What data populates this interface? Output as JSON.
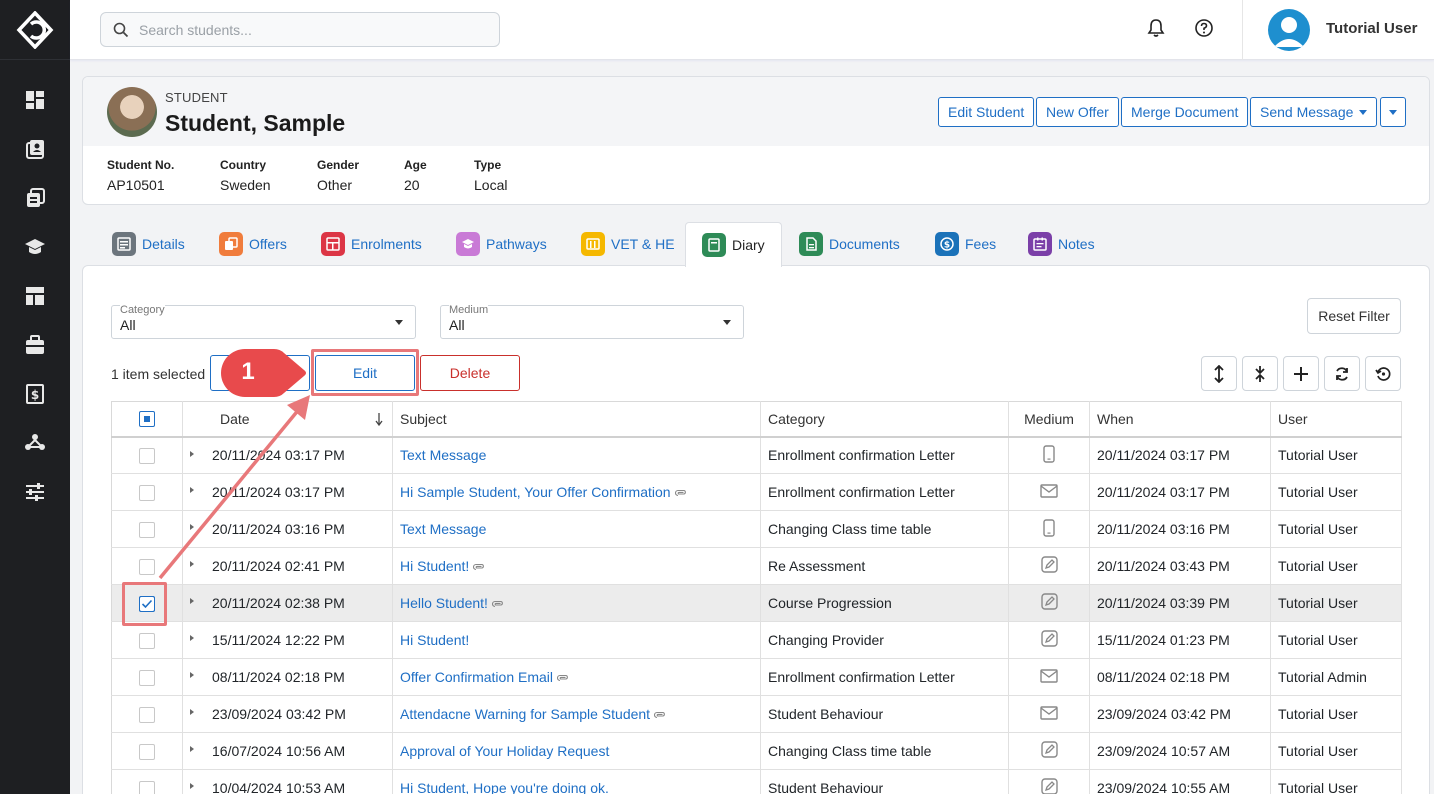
{
  "search": {
    "placeholder": "Search students..."
  },
  "user": {
    "name": "Tutorial User"
  },
  "student": {
    "role": "STUDENT",
    "name": "Student, Sample",
    "buttons": {
      "edit": "Edit Student",
      "offer": "New Offer",
      "merge": "Merge Document",
      "send": "Send Message"
    },
    "fields": [
      {
        "label": "Student No.",
        "value": "AP10501"
      },
      {
        "label": "Country",
        "value": "Sweden"
      },
      {
        "label": "Gender",
        "value": "Other"
      },
      {
        "label": "Age",
        "value": "20"
      },
      {
        "label": "Type",
        "value": "Local"
      }
    ]
  },
  "tabs": [
    {
      "label": "Details",
      "color": "#6c757d"
    },
    {
      "label": "Offers",
      "color": "#f07c3c"
    },
    {
      "label": "Enrolments",
      "color": "#dc3545"
    },
    {
      "label": "Pathways",
      "color": "#c97ad6"
    },
    {
      "label": "VET & HE",
      "color": "#f5b800"
    },
    {
      "label": "Diary",
      "color": "#2e8b57"
    },
    {
      "label": "Documents",
      "color": "#2e8b57"
    },
    {
      "label": "Fees",
      "color": "#1b72b9"
    },
    {
      "label": "Notes",
      "color": "#7b3fa8"
    }
  ],
  "filters": {
    "category": {
      "label": "Category",
      "value": "All"
    },
    "medium": {
      "label": "Medium",
      "value": "All"
    },
    "reset": "Reset Filter"
  },
  "selection": {
    "text": "1 item selected",
    "edit": "Edit",
    "delete": "Delete"
  },
  "annotation": {
    "step": "1"
  },
  "table": {
    "headers": {
      "date": "Date",
      "subject": "Subject",
      "category": "Category",
      "medium": "Medium",
      "when": "When",
      "user": "User"
    },
    "rows": [
      {
        "date": "20/11/2024 03:17 PM",
        "subject": "Text Message",
        "attach": false,
        "category": "Enrollment confirmation Letter",
        "medium": "phone",
        "when": "20/11/2024 03:17 PM",
        "user": "Tutorial User",
        "checked": false
      },
      {
        "date": "20/11/2024 03:17 PM",
        "subject": "Hi Sample Student, Your Offer Confirmation",
        "attach": true,
        "category": "Enrollment confirmation Letter",
        "medium": "email",
        "when": "20/11/2024 03:17 PM",
        "user": "Tutorial User",
        "checked": false
      },
      {
        "date": "20/11/2024 03:16 PM",
        "subject": "Text Message",
        "attach": false,
        "category": "Changing Class time table",
        "medium": "phone",
        "when": "20/11/2024 03:16 PM",
        "user": "Tutorial User",
        "checked": false
      },
      {
        "date": "20/11/2024 02:41 PM",
        "subject": "Hi Student!",
        "attach": true,
        "category": "Re Assessment",
        "medium": "note",
        "when": "20/11/2024 03:43 PM",
        "user": "Tutorial User",
        "checked": false
      },
      {
        "date": "20/11/2024 02:38 PM",
        "subject": "Hello Student!",
        "attach": true,
        "category": "Course Progression",
        "medium": "note",
        "when": "20/11/2024 03:39 PM",
        "user": "Tutorial User",
        "checked": true
      },
      {
        "date": "15/11/2024 12:22 PM",
        "subject": "Hi Student!",
        "attach": false,
        "category": "Changing Provider",
        "medium": "note",
        "when": "15/11/2024 01:23 PM",
        "user": "Tutorial User",
        "checked": false
      },
      {
        "date": "08/11/2024 02:18 PM",
        "subject": "Offer Confirmation Email",
        "attach": true,
        "category": "Enrollment confirmation Letter",
        "medium": "email",
        "when": "08/11/2024 02:18 PM",
        "user": "Tutorial Admin",
        "checked": false
      },
      {
        "date": "23/09/2024 03:42 PM",
        "subject": "Attendacne Warning for Sample Student",
        "attach": true,
        "category": "Student Behaviour",
        "medium": "email",
        "when": "23/09/2024 03:42 PM",
        "user": "Tutorial User",
        "checked": false
      },
      {
        "date": "16/07/2024 10:56 AM",
        "subject": "Approval of Your Holiday Request",
        "attach": false,
        "category": "Changing Class time table",
        "medium": "note",
        "when": "23/09/2024 10:57 AM",
        "user": "Tutorial User",
        "checked": false
      },
      {
        "date": "10/04/2024 10:53 AM",
        "subject": "Hi Student, Hope you're doing ok.",
        "attach": false,
        "category": "Student Behaviour",
        "medium": "note",
        "when": "23/09/2024 10:55 AM",
        "user": "Tutorial User",
        "checked": false
      }
    ]
  }
}
